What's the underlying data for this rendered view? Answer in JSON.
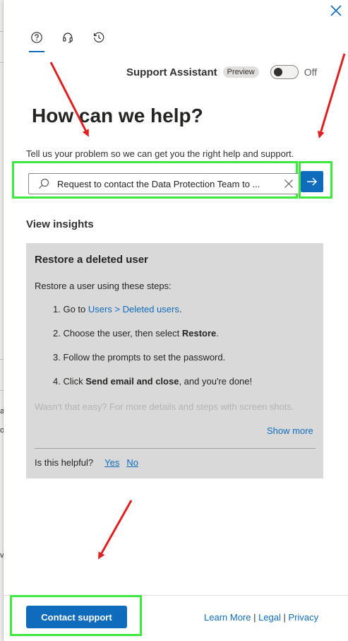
{
  "background": {
    "glyphs": [
      "a",
      "o",
      "v"
    ]
  },
  "tabs": [
    {
      "icon": "help-circle-icon",
      "active": true
    },
    {
      "icon": "headset-icon",
      "active": false
    },
    {
      "icon": "history-icon",
      "active": false
    }
  ],
  "assistant": {
    "label": "Support Assistant",
    "badge": "Preview",
    "toggle_state": "Off"
  },
  "main": {
    "heading": "How can we help?",
    "help_text": "Tell us your problem so we can get you the right help and support."
  },
  "search": {
    "value": "Request to contact the Data Protection Team to ..."
  },
  "insights": {
    "title": "View insights",
    "card": {
      "title": "Restore a deleted user",
      "intro": "Restore a user using these steps:",
      "step1_prefix": "1. Go to ",
      "step1_link": "Users > Deleted users",
      "step1_suffix": ".",
      "step2_prefix": "2. Choose the user, then select ",
      "step2_bold": "Restore",
      "step2_suffix": ".",
      "step3": "3. Follow the prompts to set the password.",
      "step4_prefix": "4. Click ",
      "step4_bold": "Send email and close",
      "step4_suffix": ", and you're done!",
      "faded_text": "Wasn't that easy? For more details and steps with screen shots.",
      "show_more": "Show more",
      "helpful_label": "Is this helpful?",
      "yes": "Yes",
      "no": "No"
    }
  },
  "footer": {
    "contact_label": "Contact support",
    "learn_more": "Learn More",
    "separator": " | ",
    "legal": "Legal",
    "privacy": "Privacy"
  },
  "colors": {
    "accent": "#0f6cbd",
    "highlight_box": "#3ee83e",
    "annotation_arrow": "#e02020",
    "card_bg": "#d9d9d9"
  }
}
